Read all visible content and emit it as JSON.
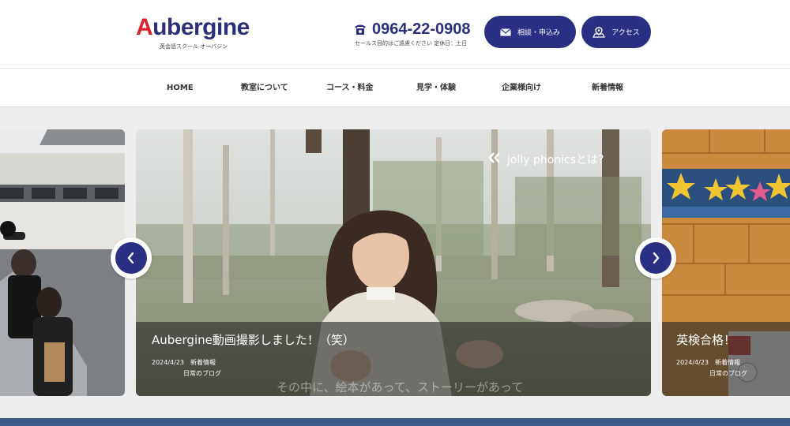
{
  "header": {
    "logo": {
      "text_a": "A",
      "text_rest": "ubergine",
      "subtitle": "英会話スクール オーバジン"
    },
    "phone": {
      "number": "0964-22-0908",
      "note": "セールス目的はご遠慮ください 定休日：土日"
    },
    "buttons": {
      "contact": "相談・申込み",
      "access": "アクセス"
    }
  },
  "nav": {
    "items": [
      "HOME",
      "教室について",
      "コース・料金",
      "見学・体験",
      "企業様向け",
      "新着情報"
    ]
  },
  "slides": {
    "main": {
      "tag": "jolly phonicsとは？",
      "title": "Aubergine動画撮影しました！（笑）",
      "date": "2024/4/23",
      "category1": "新着情報",
      "category2": "日常のブログ",
      "subtitle": "その中に、絵本があって、ストーリーがあって"
    },
    "right": {
      "title": "英検合格！",
      "date": "2024/4/23",
      "category1": "新着情報",
      "category2": "日常のブログ"
    }
  },
  "colors": {
    "brand": "#2a2f83",
    "accent": "#d8232a",
    "footer": "#3d5a88"
  }
}
